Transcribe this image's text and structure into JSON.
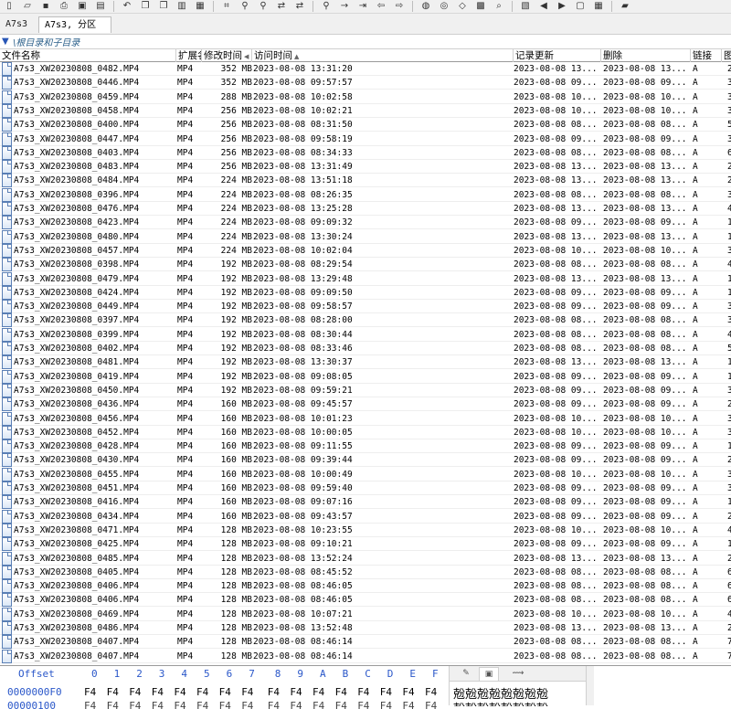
{
  "toolbar": {
    "icons": [
      "new-icon",
      "open-icon",
      "save-icon",
      "print-icon",
      "save-all-icon",
      "properties-icon",
      "undo-icon",
      "copy-icon",
      "copy-hex-icon",
      "paste-icon",
      "paste-hex-icon",
      "goto-binary-icon",
      "find-icon",
      "find-hex-icon",
      "replace-icon",
      "replace-hex-icon",
      "find-next-icon",
      "goto-offset-icon",
      "jump-icon",
      "back-icon",
      "forward-icon",
      "disk-icon",
      "copy-disk-icon",
      "erase-icon",
      "calculator-icon",
      "search-icon",
      "gallery-icon",
      "prev-icon",
      "next-icon",
      "snapshot-icon",
      "table-icon",
      "book-icon"
    ],
    "hex_label": "HEX",
    "bin_label": "010"
  },
  "tabs": [
    {
      "label": "A7s3"
    },
    {
      "label": "A7s3, 分区 1"
    }
  ],
  "pathbar": {
    "filter_icon": "filter-icon",
    "path": "\\根目录和子目录"
  },
  "columns": {
    "name": "文件名称",
    "ext": "扩展名",
    "mod": "修改时间",
    "access": "访问时间",
    "record": "记录更新",
    "deleted": "删除",
    "link": "链接",
    "extra": "图"
  },
  "files": [
    {
      "name": "A7s3_XW20230808_0482.MP4",
      "ext": "MP4",
      "size": "352 MB",
      "mod": "2023-08-08   13:31:20",
      "rec": "2023-08-08   13...",
      "del": "2023-08-08   13...",
      "link": "A",
      "x": "2"
    },
    {
      "name": "A7s3_XW20230808_0446.MP4",
      "ext": "MP4",
      "size": "352 MB",
      "mod": "2023-08-08   09:57:57",
      "rec": "2023-08-08   09...",
      "del": "2023-08-08   09...",
      "link": "A",
      "x": "3"
    },
    {
      "name": "A7s3_XW20230808_0459.MP4",
      "ext": "MP4",
      "size": "288 MB",
      "mod": "2023-08-08   10:02:58",
      "rec": "2023-08-08   10...",
      "del": "2023-08-08   10...",
      "link": "A",
      "x": "3"
    },
    {
      "name": "A7s3_XW20230808_0458.MP4",
      "ext": "MP4",
      "size": "256 MB",
      "mod": "2023-08-08   10:02:21",
      "rec": "2023-08-08   10...",
      "del": "2023-08-08   10...",
      "link": "A",
      "x": "3"
    },
    {
      "name": "A7s3_XW20230808_0400.MP4",
      "ext": "MP4",
      "size": "256 MB",
      "mod": "2023-08-08   08:31:50",
      "rec": "2023-08-08   08...",
      "del": "2023-08-08   08...",
      "link": "A",
      "x": "5"
    },
    {
      "name": "A7s3_XW20230808_0447.MP4",
      "ext": "MP4",
      "size": "256 MB",
      "mod": "2023-08-08   09:58:19",
      "rec": "2023-08-08   09...",
      "del": "2023-08-08   09...",
      "link": "A",
      "x": "3"
    },
    {
      "name": "A7s3_XW20230808_0403.MP4",
      "ext": "MP4",
      "size": "256 MB",
      "mod": "2023-08-08   08:34:33",
      "rec": "2023-08-08   08...",
      "del": "2023-08-08   08...",
      "link": "A",
      "x": "6"
    },
    {
      "name": "A7s3_XW20230808_0483.MP4",
      "ext": "MP4",
      "size": "256 MB",
      "mod": "2023-08-08   13:31:49",
      "rec": "2023-08-08   13...",
      "del": "2023-08-08   13...",
      "link": "A",
      "x": "2"
    },
    {
      "name": "A7s3_XW20230808_0484.MP4",
      "ext": "MP4",
      "size": "224 MB",
      "mod": "2023-08-08   13:51:18",
      "rec": "2023-08-08   13...",
      "del": "2023-08-08   13...",
      "link": "A",
      "x": "2"
    },
    {
      "name": "A7s3_XW20230808_0396.MP4",
      "ext": "MP4",
      "size": "224 MB",
      "mod": "2023-08-08   08:26:35",
      "rec": "2023-08-08   08...",
      "del": "2023-08-08   08...",
      "link": "A",
      "x": "3"
    },
    {
      "name": "A7s3_XW20230808_0476.MP4",
      "ext": "MP4",
      "size": "224 MB",
      "mod": "2023-08-08   13:25:28",
      "rec": "2023-08-08   13...",
      "del": "2023-08-08   13...",
      "link": "A",
      "x": "4"
    },
    {
      "name": "A7s3_XW20230808_0423.MP4",
      "ext": "MP4",
      "size": "224 MB",
      "mod": "2023-08-08   09:09:32",
      "rec": "2023-08-08   09...",
      "del": "2023-08-08   09...",
      "link": "A",
      "x": "1"
    },
    {
      "name": "A7s3_XW20230808_0480.MP4",
      "ext": "MP4",
      "size": "224 MB",
      "mod": "2023-08-08   13:30:24",
      "rec": "2023-08-08   13...",
      "del": "2023-08-08   13...",
      "link": "A",
      "x": "1"
    },
    {
      "name": "A7s3_XW20230808_0457.MP4",
      "ext": "MP4",
      "size": "224 MB",
      "mod": "2023-08-08   10:02:04",
      "rec": "2023-08-08   10...",
      "del": "2023-08-08   10...",
      "link": "A",
      "x": "3"
    },
    {
      "name": "A7s3_XW20230808_0398.MP4",
      "ext": "MP4",
      "size": "192 MB",
      "mod": "2023-08-08   08:29:54",
      "rec": "2023-08-08   08...",
      "del": "2023-08-08   08...",
      "link": "A",
      "x": "4"
    },
    {
      "name": "A7s3_XW20230808_0479.MP4",
      "ext": "MP4",
      "size": "192 MB",
      "mod": "2023-08-08   13:29:48",
      "rec": "2023-08-08   13...",
      "del": "2023-08-08   13...",
      "link": "A",
      "x": "1"
    },
    {
      "name": "A7s3_XW20230808_0424.MP4",
      "ext": "MP4",
      "size": "192 MB",
      "mod": "2023-08-08   09:09:50",
      "rec": "2023-08-08   09...",
      "del": "2023-08-08   09...",
      "link": "A",
      "x": "1"
    },
    {
      "name": "A7s3_XW20230808_0449.MP4",
      "ext": "MP4",
      "size": "192 MB",
      "mod": "2023-08-08   09:58:57",
      "rec": "2023-08-08   09...",
      "del": "2023-08-08   09...",
      "link": "A",
      "x": "3"
    },
    {
      "name": "A7s3_XW20230808_0397.MP4",
      "ext": "MP4",
      "size": "192 MB",
      "mod": "2023-08-08   08:28:00",
      "rec": "2023-08-08   08...",
      "del": "2023-08-08   08...",
      "link": "A",
      "x": "3"
    },
    {
      "name": "A7s3_XW20230808_0399.MP4",
      "ext": "MP4",
      "size": "192 MB",
      "mod": "2023-08-08   08:30:44",
      "rec": "2023-08-08   08...",
      "del": "2023-08-08   08...",
      "link": "A",
      "x": "4"
    },
    {
      "name": "A7s3_XW20230808_0402.MP4",
      "ext": "MP4",
      "size": "192 MB",
      "mod": "2023-08-08   08:33:46",
      "rec": "2023-08-08   08...",
      "del": "2023-08-08   08...",
      "link": "A",
      "x": "5"
    },
    {
      "name": "A7s3_XW20230808_0481.MP4",
      "ext": "MP4",
      "size": "192 MB",
      "mod": "2023-08-08   13:30:37",
      "rec": "2023-08-08   13...",
      "del": "2023-08-08   13...",
      "link": "A",
      "x": "1"
    },
    {
      "name": "A7s3_XW20230808_0419.MP4",
      "ext": "MP4",
      "size": "192 MB",
      "mod": "2023-08-08   09:08:05",
      "rec": "2023-08-08   09...",
      "del": "2023-08-08   09...",
      "link": "A",
      "x": "1"
    },
    {
      "name": "A7s3_XW20230808_0450.MP4",
      "ext": "MP4",
      "size": "192 MB",
      "mod": "2023-08-08   09:59:21",
      "rec": "2023-08-08   09...",
      "del": "2023-08-08   09...",
      "link": "A",
      "x": "3"
    },
    {
      "name": "A7s3_XW20230808_0436.MP4",
      "ext": "MP4",
      "size": "160 MB",
      "mod": "2023-08-08   09:45:57",
      "rec": "2023-08-08   09...",
      "del": "2023-08-08   09...",
      "link": "A",
      "x": "2"
    },
    {
      "name": "A7s3_XW20230808_0456.MP4",
      "ext": "MP4",
      "size": "160 MB",
      "mod": "2023-08-08   10:01:23",
      "rec": "2023-08-08   10...",
      "del": "2023-08-08   10...",
      "link": "A",
      "x": "3"
    },
    {
      "name": "A7s3_XW20230808_0452.MP4",
      "ext": "MP4",
      "size": "160 MB",
      "mod": "2023-08-08   10:00:05",
      "rec": "2023-08-08   10...",
      "del": "2023-08-08   10...",
      "link": "A",
      "x": "3"
    },
    {
      "name": "A7s3_XW20230808_0428.MP4",
      "ext": "MP4",
      "size": "160 MB",
      "mod": "2023-08-08   09:11:55",
      "rec": "2023-08-08   09...",
      "del": "2023-08-08   09...",
      "link": "A",
      "x": "1"
    },
    {
      "name": "A7s3_XW20230808_0430.MP4",
      "ext": "MP4",
      "size": "160 MB",
      "mod": "2023-08-08   09:39:44",
      "rec": "2023-08-08   09...",
      "del": "2023-08-08   09...",
      "link": "A",
      "x": "2"
    },
    {
      "name": "A7s3_XW20230808_0455.MP4",
      "ext": "MP4",
      "size": "160 MB",
      "mod": "2023-08-08   10:00:49",
      "rec": "2023-08-08   10...",
      "del": "2023-08-08   10...",
      "link": "A",
      "x": "3"
    },
    {
      "name": "A7s3_XW20230808_0451.MP4",
      "ext": "MP4",
      "size": "160 MB",
      "mod": "2023-08-08   09:59:40",
      "rec": "2023-08-08   09...",
      "del": "2023-08-08   09...",
      "link": "A",
      "x": "3"
    },
    {
      "name": "A7s3_XW20230808_0416.MP4",
      "ext": "MP4",
      "size": "160 MB",
      "mod": "2023-08-08   09:07:16",
      "rec": "2023-08-08   09...",
      "del": "2023-08-08   09...",
      "link": "A",
      "x": "1"
    },
    {
      "name": "A7s3_XW20230808_0434.MP4",
      "ext": "MP4",
      "size": "160 MB",
      "mod": "2023-08-08   09:43:57",
      "rec": "2023-08-08   09...",
      "del": "2023-08-08   09...",
      "link": "A",
      "x": "2"
    },
    {
      "name": "A7s3_XW20230808_0471.MP4",
      "ext": "MP4",
      "size": "128 MB",
      "mod": "2023-08-08   10:23:55",
      "rec": "2023-08-08   10...",
      "del": "2023-08-08   10...",
      "link": "A",
      "x": "4"
    },
    {
      "name": "A7s3_XW20230808_0425.MP4",
      "ext": "MP4",
      "size": "128 MB",
      "mod": "2023-08-08   09:10:21",
      "rec": "2023-08-08   09...",
      "del": "2023-08-08   09...",
      "link": "A",
      "x": "1"
    },
    {
      "name": "A7s3_XW20230808_0485.MP4",
      "ext": "MP4",
      "size": "128 MB",
      "mod": "2023-08-08   13:52:24",
      "rec": "2023-08-08   13...",
      "del": "2023-08-08   13...",
      "link": "A",
      "x": "2"
    },
    {
      "name": "A7s3_XW20230808_0405.MP4",
      "ext": "MP4",
      "size": "128 MB",
      "mod": "2023-08-08   08:45:52",
      "rec": "2023-08-08   08...",
      "del": "2023-08-08   08...",
      "link": "A",
      "x": "6"
    },
    {
      "name": "A7s3_XW20230808_0406.MP4",
      "ext": "MP4",
      "size": "128 MB",
      "mod": "2023-08-08   08:46:05",
      "rec": "2023-08-08   08...",
      "del": "2023-08-08   08...",
      "link": "A",
      "x": "6"
    },
    {
      "name": "A7s3_XW20230808_0406.MP4",
      "ext": "MP4",
      "size": "128 MB",
      "mod": "2023-08-08   08:46:05",
      "rec": "2023-08-08   08...",
      "del": "2023-08-08   08...",
      "link": "A",
      "x": "6"
    },
    {
      "name": "A7s3_XW20230808_0469.MP4",
      "ext": "MP4",
      "size": "128 MB",
      "mod": "2023-08-08   10:07:21",
      "rec": "2023-08-08   10...",
      "del": "2023-08-08   10...",
      "link": "A",
      "x": "4"
    },
    {
      "name": "A7s3_XW20230808_0486.MP4",
      "ext": "MP4",
      "size": "128 MB",
      "mod": "2023-08-08   13:52:48",
      "rec": "2023-08-08   13...",
      "del": "2023-08-08   13...",
      "link": "A",
      "x": "2"
    },
    {
      "name": "A7s3_XW20230808_0407.MP4",
      "ext": "MP4",
      "size": "128 MB",
      "mod": "2023-08-08   08:46:14",
      "rec": "2023-08-08   08...",
      "del": "2023-08-08   08...",
      "link": "A",
      "x": "7"
    },
    {
      "name": "A7s3_XW20230808_0407.MP4",
      "ext": "MP4",
      "size": "128 MB",
      "mod": "2023-08-08   08:46:14",
      "rec": "2023-08-08   08...",
      "del": "2023-08-08   08...",
      "link": "A",
      "x": "7"
    }
  ],
  "hex": {
    "offset_label": "Offset",
    "columns": [
      "0",
      "1",
      "2",
      "3",
      "4",
      "5",
      "6",
      "7",
      "8",
      "9",
      "A",
      "B",
      "C",
      "D",
      "E",
      "F"
    ],
    "row1_offset": "0000000F0",
    "row1_bytes": [
      "F4",
      "F4",
      "F4",
      "F4",
      "F4",
      "F4",
      "F4",
      "F4",
      "F4",
      "F4",
      "F4",
      "F4",
      "F4",
      "F4",
      "F4",
      "F4"
    ],
    "row2_offset": "00000100",
    "row2_bytes": [
      "F4",
      "F4",
      "F4",
      "F4",
      "F4",
      "F4",
      "F4",
      "F4",
      "F4",
      "F4",
      "F4",
      "F4",
      "F4",
      "F4",
      "F4",
      "F4"
    ],
    "text_row1": "兝兝兝兝兝兝兝兝",
    "text_row2": "兝兝兝兝兝兝兝兝",
    "text_tabs": [
      "pencil-icon",
      "image-icon",
      "scroll-icon"
    ]
  }
}
